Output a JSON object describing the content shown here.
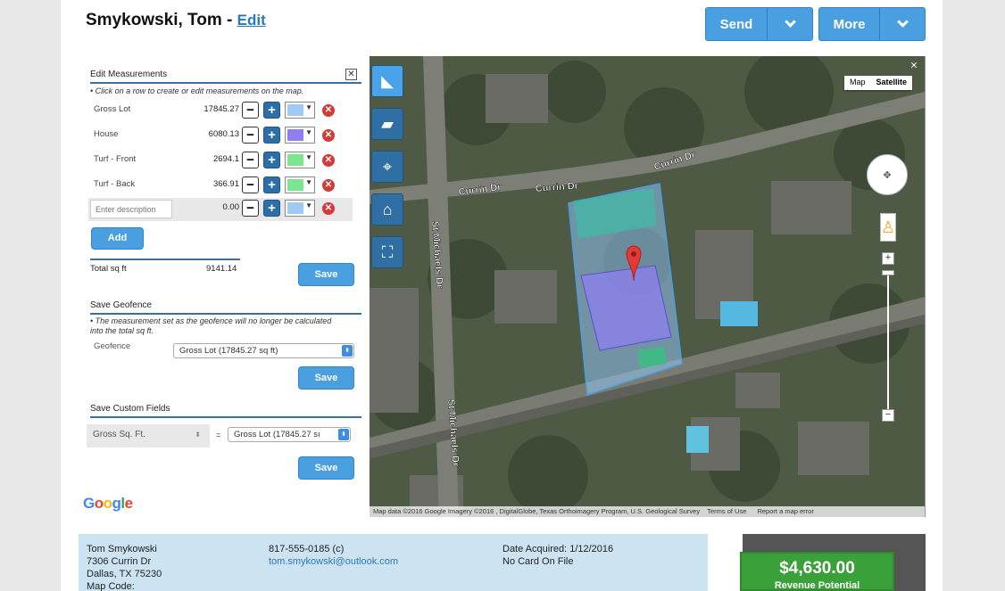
{
  "header": {
    "customer_name": "Smykowski, Tom - ",
    "edit_label": "Edit",
    "send_label": "Send",
    "more_label": "More"
  },
  "colors": {
    "accent": "#4a9fe0",
    "delete": "#d43a3a",
    "revenue": "#3aa03a"
  },
  "edit_measurements": {
    "title": "Edit Measurements",
    "close_label": "✕",
    "note": "• Click on a row to create or edit measurements on the map.",
    "rows": [
      {
        "name": "Gross Lot",
        "value": "17845.27",
        "color": "#9fcbf2"
      },
      {
        "name": "House",
        "value": "6080.13",
        "color": "#8d7ff0"
      },
      {
        "name": "Turf - Front",
        "value": "2694.1",
        "color": "#7be58f"
      },
      {
        "name": "Turf - Back",
        "value": "366.91",
        "color": "#7be58f"
      }
    ],
    "new_row": {
      "placeholder": "Enter description",
      "value": "0.00",
      "color": "#9fcbf2"
    },
    "add_label": "Add",
    "total_label": "Total sq ft",
    "total_value": "9141.14",
    "save_label": "Save"
  },
  "geofence": {
    "title": "Save Geofence",
    "note": "• The measurement set as the geofence will no longer be calculated into the total sq ft.",
    "field_label": "Geofence",
    "selected": "Gross Lot (17845.27 sq ft)",
    "save_label": "Save"
  },
  "custom_fields": {
    "title": "Save Custom Fields",
    "field_selected": "Gross Sq. Ft.",
    "equals": "=",
    "value_selected": "Gross Lot (17845.27 sı",
    "save_label": "Save"
  },
  "map": {
    "map_label": "Map",
    "satellite_label": "Satellite",
    "close_label": "✕",
    "streets": [
      "Currin Dr",
      "Currin Dr",
      "Currin Dr",
      "St Michaels Dr",
      "St Michaels Dr"
    ],
    "attribution": "Map data ©2016 Google Imagery ©2016 , DigitalGlobe, Texas Orthoimagery Program, U.S. Geological Survey",
    "terms_label": "Terms of Use",
    "report_label": "Report a map error",
    "google_label": "Google"
  },
  "contact": {
    "name": "Tom Smykowski",
    "street": "7306 Currin Dr",
    "city": "Dallas, TX 75230",
    "map_code": "Map Code:",
    "phone": "817-555-0185 (c)",
    "email": "tom.smykowski@outlook.com",
    "date_acquired": "Date Acquired: 1/12/2016",
    "card": "No Card On File"
  },
  "revenue": {
    "amount": "$4,630.00",
    "label": "Revenue Potential"
  }
}
